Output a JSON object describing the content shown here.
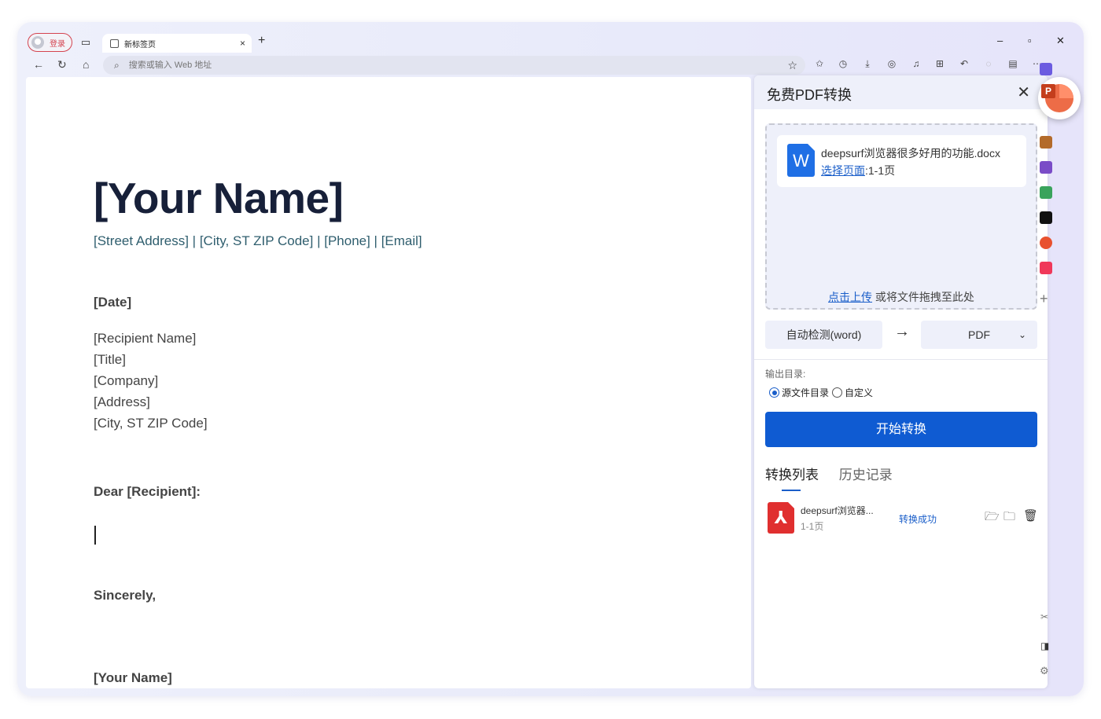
{
  "browser": {
    "login_label": "登录",
    "tab_title": "新标签页",
    "tab_close": "×",
    "new_tab": "+",
    "address_placeholder": "搜索或输入 Web 地址",
    "window_controls": [
      "–",
      "▫",
      "✕"
    ]
  },
  "document": {
    "name": "[Your Name]",
    "contact": "[Street Address] | [City, ST ZIP Code] | [Phone] | [Email]",
    "date": "[Date]",
    "recipient_lines": [
      "[Recipient Name]",
      "[Title]",
      "[Company]",
      "[Address]",
      "[City, ST ZIP Code]"
    ],
    "salutation": "Dear [Recipient]:",
    "closing": "Sincerely,",
    "signature": "[Your Name]"
  },
  "pdf_panel": {
    "title": "免费PDF转换",
    "file": {
      "icon_letter": "W",
      "name": "deepsurf浏览器很多好用的功能.docx",
      "select_pages_link": "选择页面",
      "pages": ":1-1页"
    },
    "upload_link": "点击上传",
    "upload_hint": " 或将文件拖拽至此处",
    "source_format": "自动检测(word)",
    "target_format": "PDF",
    "output_label": "输出目录:",
    "radio_source": "源文件目录",
    "radio_custom": "自定义",
    "start_button": "开始转换",
    "tab_list": "转换列表",
    "tab_history": "历史记录",
    "conversions": [
      {
        "name": "deepsurf浏览器...",
        "pages": "1-1页",
        "status": "转换成功"
      }
    ]
  },
  "colors": {
    "accent_blue": "#0f5bd2",
    "link_blue": "#1a5ec9",
    "login_red": "#d4434f",
    "pdf_red": "#e02f2f",
    "word_blue": "#1f6fe5",
    "name_navy": "#172039",
    "contact_teal": "#2f5e6e"
  },
  "icons": [
    "back-arrow-icon",
    "refresh-icon",
    "home-icon",
    "search-icon",
    "star-icon",
    "favorites-icon",
    "history-icon",
    "download-icon",
    "screenshot-icon",
    "bell-icon",
    "apps-icon",
    "undo-icon",
    "wallet-icon",
    "more-icon",
    "folder-open-icon",
    "folder-icon",
    "trash-icon",
    "close-icon",
    "chevron-down-icon",
    "powerpoint-icon"
  ]
}
